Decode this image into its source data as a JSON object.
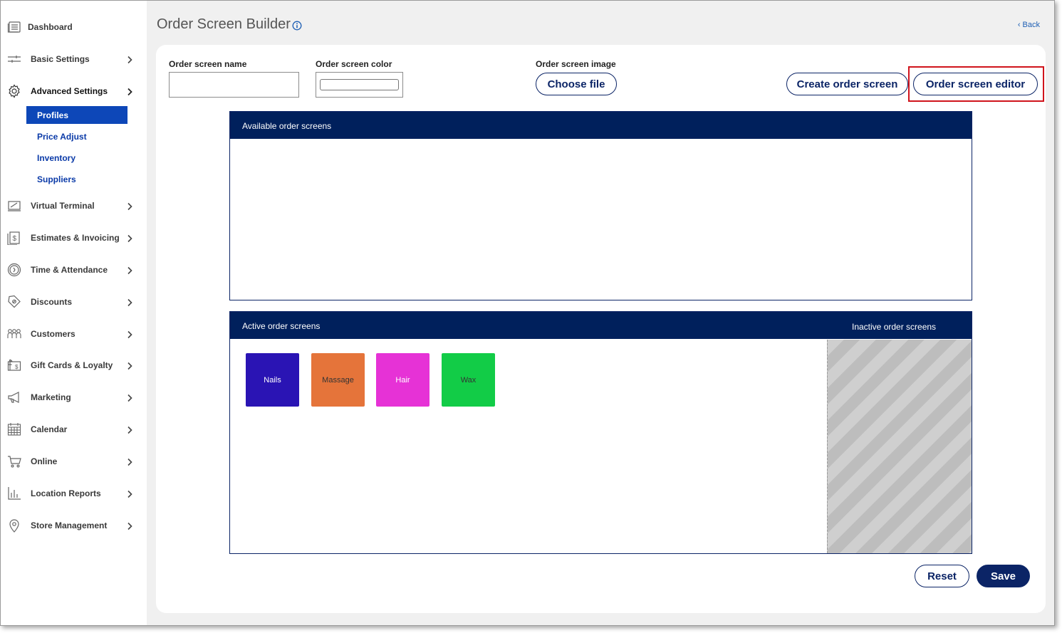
{
  "sidebar": {
    "items": [
      {
        "label": "Dashboard",
        "icon": "dashboard-icon",
        "chevron": false
      },
      {
        "label": "Basic Settings",
        "icon": "sliders-icon",
        "chevron": true
      },
      {
        "label": "Advanced Settings",
        "icon": "gear-icon",
        "chevron": true,
        "expanded": true
      },
      {
        "label": "Virtual Terminal",
        "icon": "terminal-icon",
        "chevron": true
      },
      {
        "label": "Estimates & Invoicing",
        "icon": "invoice-icon",
        "chevron": true
      },
      {
        "label": "Time & Attendance",
        "icon": "clock-icon",
        "chevron": true
      },
      {
        "label": "Discounts",
        "icon": "tag-icon",
        "chevron": true
      },
      {
        "label": "Customers",
        "icon": "customers-icon",
        "chevron": true
      },
      {
        "label": "Gift Cards & Loyalty",
        "icon": "gift-card-icon",
        "chevron": true
      },
      {
        "label": "Marketing",
        "icon": "megaphone-icon",
        "chevron": true
      },
      {
        "label": "Calendar",
        "icon": "calendar-icon",
        "chevron": true
      },
      {
        "label": "Online",
        "icon": "cart-icon",
        "chevron": true
      },
      {
        "label": "Location Reports",
        "icon": "bar-chart-icon",
        "chevron": true
      },
      {
        "label": "Store Management",
        "icon": "location-pin-icon",
        "chevron": true
      }
    ],
    "subitems": [
      {
        "label": "Profiles",
        "active": true
      },
      {
        "label": "Price Adjust",
        "active": false
      },
      {
        "label": "Inventory",
        "active": false
      },
      {
        "label": "Suppliers",
        "active": false
      }
    ]
  },
  "header": {
    "title": "Order Screen Builder",
    "back_label": "‹ Back"
  },
  "form": {
    "name_label": "Order screen name",
    "name_value": "",
    "color_label": "Order screen color",
    "image_label": "Order screen image",
    "choose_file_label": "Choose file",
    "create_label": "Create order screen",
    "editor_label": "Order screen editor"
  },
  "available": {
    "title": "Available order screens"
  },
  "active": {
    "title": "Active order screens",
    "inactive_title": "Inactive order screens",
    "tiles": [
      {
        "label": "Nails",
        "color": "#2a14b4",
        "text_color": "#ffffff"
      },
      {
        "label": "Massage",
        "color": "#e5743a",
        "text_color": "#333333"
      },
      {
        "label": "Hair",
        "color": "#e632d6",
        "text_color": "#ffffff"
      },
      {
        "label": "Wax",
        "color": "#12cc47",
        "text_color": "#333333"
      }
    ]
  },
  "footer": {
    "reset_label": "Reset",
    "save_label": "Save"
  },
  "colors": {
    "navy": "#00205c",
    "accent_blue": "#0d47b8",
    "highlight_red": "#d0141c"
  }
}
